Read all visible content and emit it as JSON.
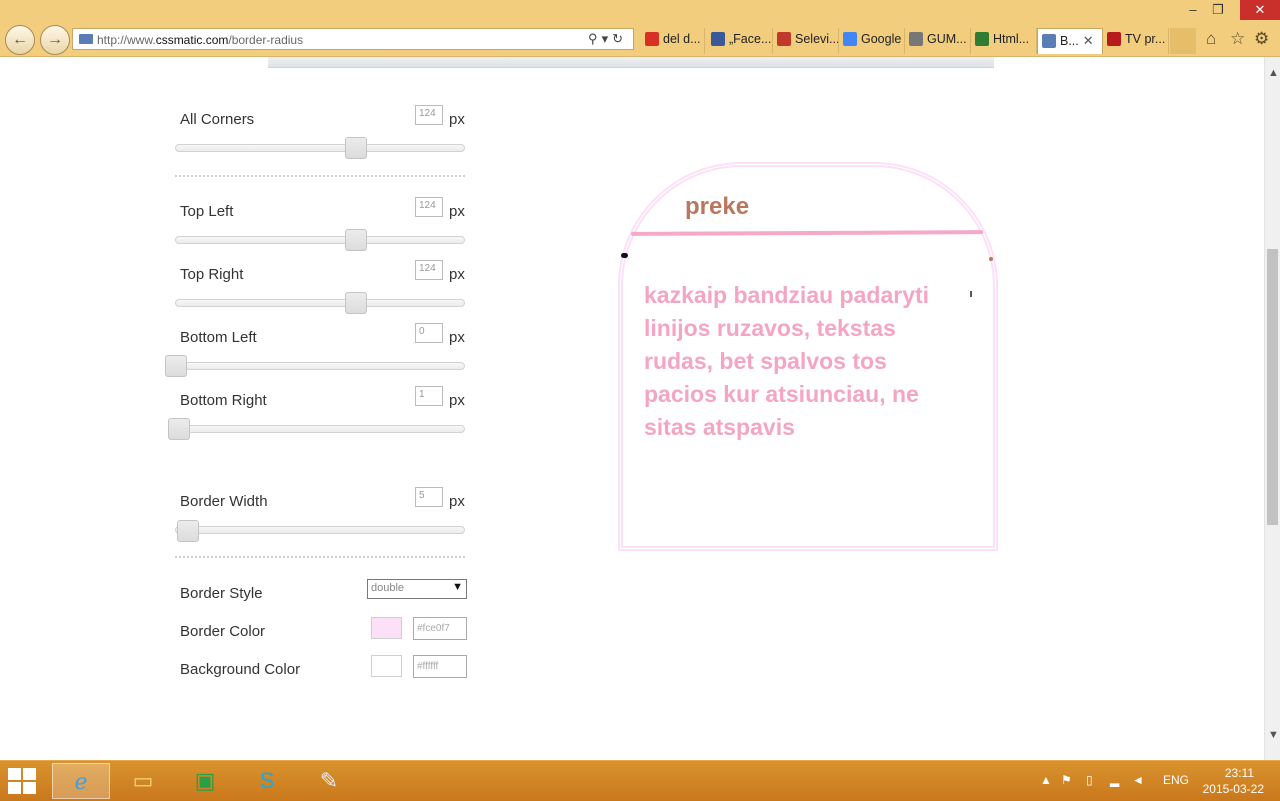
{
  "browser": {
    "url_prefix": "http://www.",
    "url_domain": "cssmatic.com",
    "url_path": "/border-radius",
    "tabs": [
      {
        "label": "del d...",
        "fav_color": "#d93025"
      },
      {
        "label": "„Face...",
        "fav_color": "#3b5998"
      },
      {
        "label": "Selevi...",
        "fav_color": "#c0392b"
      },
      {
        "label": "Google",
        "fav_color": "#4285f4"
      },
      {
        "label": "GUM...",
        "fav_color": "#777777"
      },
      {
        "label": "Html...",
        "fav_color": "#2e7d32"
      },
      {
        "label": "B...",
        "fav_color": "#5b7db5"
      },
      {
        "label": "TV pr...",
        "fav_color": "#b71c1c"
      }
    ],
    "close_tab_glyph": "✕"
  },
  "controls": {
    "all_corners": {
      "label": "All Corners",
      "value": "124",
      "unit": "px",
      "level": 0.62
    },
    "top_left": {
      "label": "Top Left",
      "value": "124",
      "unit": "px",
      "level": 0.62
    },
    "top_right": {
      "label": "Top Right",
      "value": "124",
      "unit": "px",
      "level": 0.62
    },
    "bottom_left": {
      "label": "Bottom Left",
      "value": "0",
      "unit": "px",
      "level": 0.0
    },
    "bottom_right": {
      "label": "Bottom Right",
      "value": "1",
      "unit": "px",
      "level": 0.01
    },
    "border_width": {
      "label": "Border Width",
      "value": "5",
      "unit": "px",
      "level": 0.04
    },
    "border_style": {
      "label": "Border Style",
      "value": "double"
    },
    "border_color": {
      "label": "Border Color",
      "hex": "#fce0f7"
    },
    "background_color": {
      "label": "Background Color",
      "hex": "#ffffff"
    }
  },
  "preview": {
    "title": "preke",
    "text": "kazkaip bandziau padaryti linijos ruzavos, tekstas rudas, bet spalvos tos pacios kur atsiunciau, ne sitas atspavis",
    "title_color": "#b9785e",
    "text_color": "#f5a5c4",
    "line_color": "#f5a9c7"
  },
  "taskbar": {
    "language": "ENG",
    "time": "23:11",
    "date": "2015-03-22"
  }
}
